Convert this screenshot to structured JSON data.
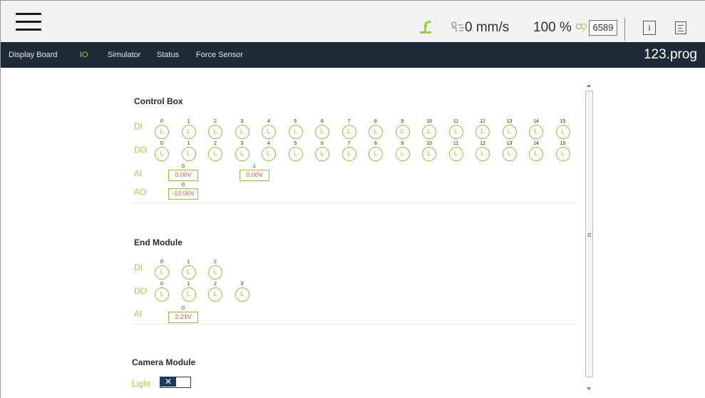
{
  "topbar": {
    "speed": "0 mm/s",
    "percent": "100 %",
    "counter": "6589",
    "info_icon": "i",
    "icons": [
      "menu-icon",
      "robot-arm-icon",
      "speed-icon",
      "connection-icon",
      "info-icon",
      "log-icon"
    ],
    "accent": "#9ad23f"
  },
  "nav": {
    "tabs": [
      {
        "label": "Display Board",
        "active": false
      },
      {
        "label": "IO",
        "active": true
      },
      {
        "label": "Simulator",
        "active": false
      },
      {
        "label": "Status",
        "active": false
      },
      {
        "label": "Force Sensor",
        "active": false
      }
    ],
    "program_name": "123.prog"
  },
  "control_box": {
    "title": "Control Box",
    "di": {
      "label": "DI",
      "ports": [
        {
          "num": "0",
          "state": "L"
        },
        {
          "num": "1",
          "state": "L"
        },
        {
          "num": "2",
          "state": "L"
        },
        {
          "num": "3",
          "state": "L"
        },
        {
          "num": "4",
          "state": "L"
        },
        {
          "num": "5",
          "state": "L"
        },
        {
          "num": "6",
          "state": "L"
        },
        {
          "num": "7",
          "state": "L"
        },
        {
          "num": "8",
          "state": "L"
        },
        {
          "num": "9",
          "state": "L"
        },
        {
          "num": "10",
          "state": "L"
        },
        {
          "num": "11",
          "state": "L"
        },
        {
          "num": "12",
          "state": "L"
        },
        {
          "num": "13",
          "state": "L"
        },
        {
          "num": "14",
          "state": "L"
        },
        {
          "num": "15",
          "state": "L"
        }
      ]
    },
    "do": {
      "label": "DO",
      "ports": [
        {
          "num": "0",
          "state": "L"
        },
        {
          "num": "1",
          "state": "L"
        },
        {
          "num": "2",
          "state": "L"
        },
        {
          "num": "3",
          "state": "L"
        },
        {
          "num": "4",
          "state": "L"
        },
        {
          "num": "5",
          "state": "L"
        },
        {
          "num": "6",
          "state": "L"
        },
        {
          "num": "7",
          "state": "L"
        },
        {
          "num": "8",
          "state": "L"
        },
        {
          "num": "9",
          "state": "L"
        },
        {
          "num": "10",
          "state": "L"
        },
        {
          "num": "11",
          "state": "L"
        },
        {
          "num": "12",
          "state": "L"
        },
        {
          "num": "13",
          "state": "L"
        },
        {
          "num": "14",
          "state": "L"
        },
        {
          "num": "15",
          "state": "L"
        }
      ]
    },
    "ai": {
      "label": "AI",
      "channels": [
        {
          "num": "0",
          "value": "0.00V"
        },
        {
          "num": "1",
          "value": "0.00V"
        }
      ]
    },
    "ao": {
      "label": "AO",
      "channels": [
        {
          "num": "0",
          "value": "-10.00V"
        }
      ]
    }
  },
  "end_module": {
    "title": "End Module",
    "di": {
      "label": "DI",
      "ports": [
        {
          "num": "0",
          "state": "L"
        },
        {
          "num": "1",
          "state": "L"
        },
        {
          "num": "2",
          "state": "L"
        }
      ]
    },
    "do": {
      "label": "DO",
      "ports": [
        {
          "num": "0",
          "state": "L"
        },
        {
          "num": "1",
          "state": "L"
        },
        {
          "num": "2",
          "state": "L"
        },
        {
          "num": "3",
          "state": "L"
        }
      ]
    },
    "ai": {
      "label": "AI",
      "channels": [
        {
          "num": "0",
          "value": "2.21V"
        }
      ]
    }
  },
  "camera_module": {
    "title": "Camera Module",
    "light_label": "Light",
    "light_toggle": "✕"
  }
}
